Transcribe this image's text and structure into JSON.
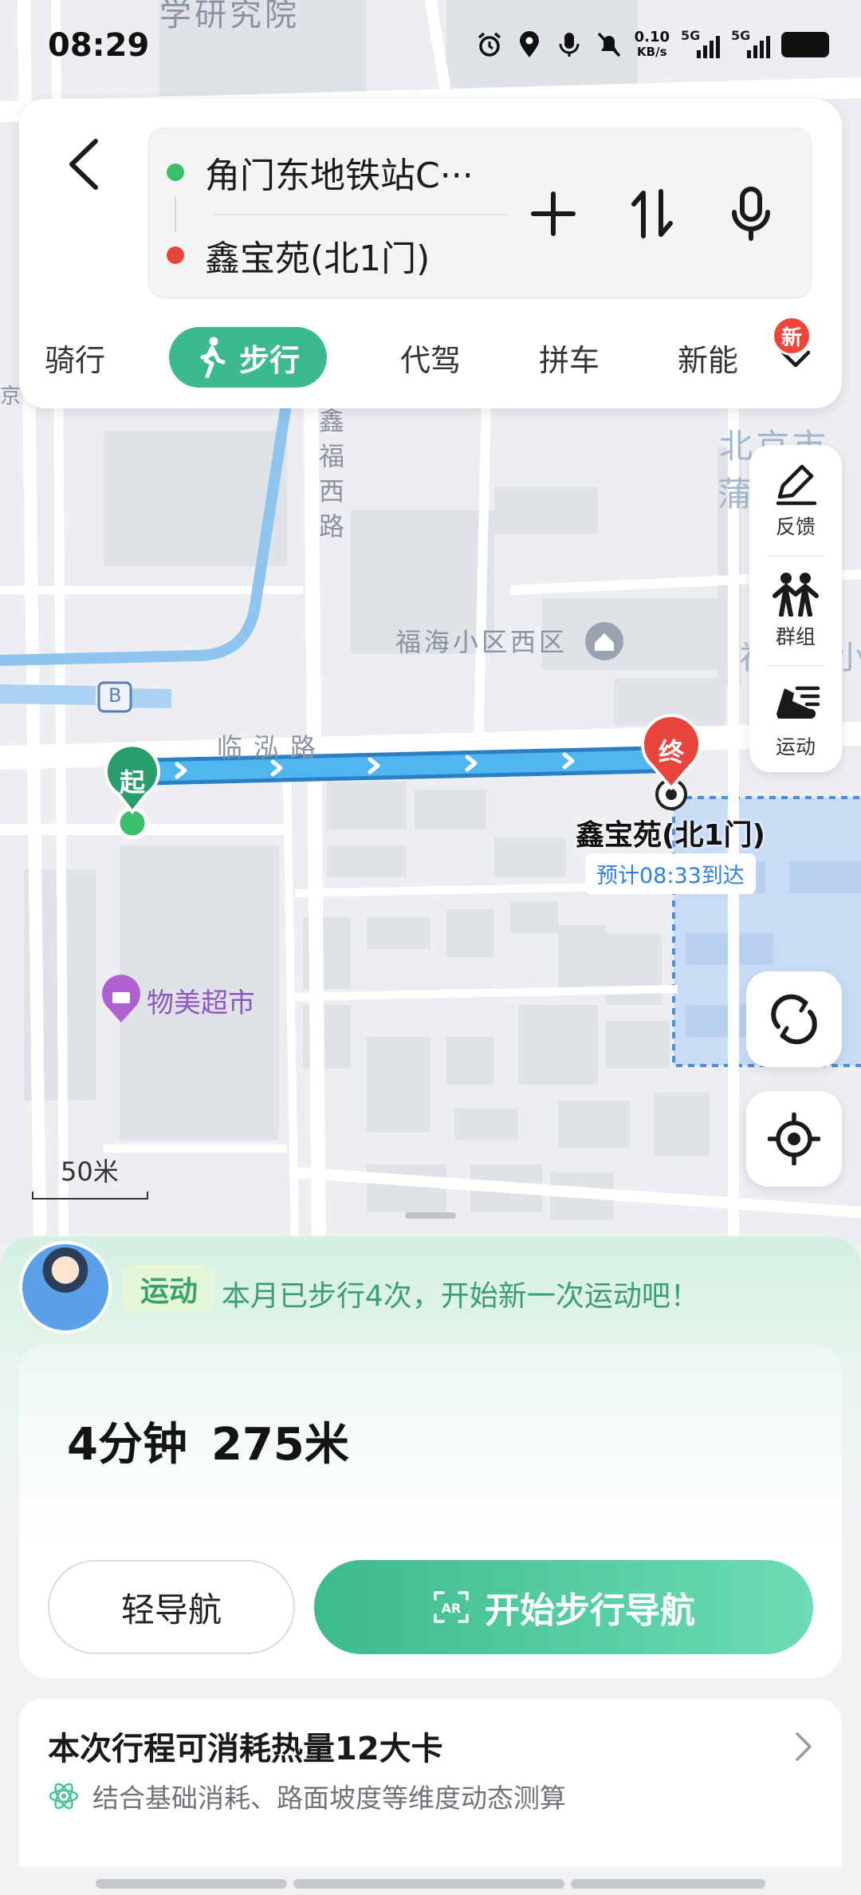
{
  "status_bar": {
    "time": "08:29",
    "net_speed_value": "0.10",
    "net_speed_unit": "KB/s",
    "sim1_label": "5G",
    "sim2_label": "5G"
  },
  "route": {
    "start_name": "角门东地铁站C···",
    "end_name": "鑫宝苑(北1门)",
    "start_color": "#3cbf6b",
    "end_color": "#e8453c"
  },
  "modes": {
    "items": [
      "骑行",
      "步行",
      "代驾",
      "拼车",
      "新能"
    ],
    "active": "步行",
    "badge": "新",
    "accent": "#3cb98d"
  },
  "side_tools": [
    {
      "label": "反馈",
      "icon": "pen-icon"
    },
    {
      "label": "群组",
      "icon": "group-icon"
    },
    {
      "label": "运动",
      "icon": "running-shoe-icon"
    }
  ],
  "map": {
    "labels": {
      "top_institute": "学研究院",
      "road_xinfu": "鑫福西路",
      "area_fuhai": "福海小区西区",
      "road_linhong": "临泓路",
      "beijing_partial": "北京市",
      "pu_partial": "蒲",
      "shop": "物美超市",
      "jing_partial": "京",
      "bus_stop": "B",
      "side_partial": "福",
      "side_partial2": "小"
    },
    "start_marker": "起",
    "end_marker": "终",
    "destination_label": "鑫宝苑(北1门)",
    "eta": "预计08:33到达",
    "scale": "50米",
    "route_color": "#4aa9e8"
  },
  "sport_banner": {
    "tag": "运动",
    "message": "本月已步行4次，开始新一次运动吧！"
  },
  "trip": {
    "duration": "4分钟",
    "distance": "275米",
    "light_nav_label": "轻导航",
    "start_nav_label": "开始步行导航"
  },
  "calorie": {
    "title": "本次行程可消耗热量12大卡",
    "subtitle": "结合基础消耗、路面坡度等维度动态测算"
  }
}
